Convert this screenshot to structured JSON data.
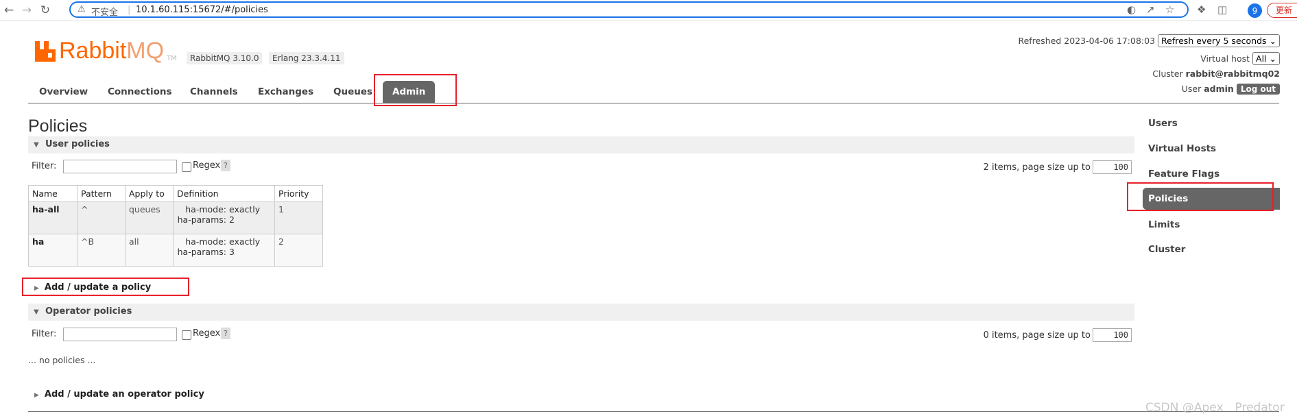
{
  "browser": {
    "security_label": "不安全",
    "url": "10.1.60.115:15672/#/policies",
    "profile_initial": "9",
    "update_label": "更新"
  },
  "header": {
    "logo_text_rabbit": "Rabbit",
    "logo_text_mq": "MQ",
    "logo_tm": "TM",
    "version": "RabbitMQ 3.10.0",
    "erlang": "Erlang 23.3.4.11",
    "refreshed_label": "Refreshed 2023-04-06 17:08:03",
    "refresh_select": "Refresh every 5 seconds",
    "virtual_host_label": "Virtual host",
    "virtual_host_value": "All",
    "cluster_label": "Cluster",
    "cluster_value": "rabbit@rabbitmq02",
    "user_label": "User",
    "user_value": "admin",
    "logout_label": "Log out"
  },
  "tabs": [
    "Overview",
    "Connections",
    "Channels",
    "Exchanges",
    "Queues",
    "Admin"
  ],
  "page_title": "Policies",
  "user_policies": {
    "title": "User policies",
    "filter_label": "Filter:",
    "regex_label": "Regex",
    "help": "?",
    "items_label": "2 items, page size up to",
    "page_size": "100",
    "columns": [
      "Name",
      "Pattern",
      "Apply to",
      "Definition",
      "Priority"
    ],
    "rows": [
      {
        "name": "ha-all",
        "pattern": "^",
        "apply_to": "queues",
        "def_key1": "ha-mode:",
        "def_val1": "exactly",
        "def_key2": "ha-params:",
        "def_val2": "2",
        "priority": "1"
      },
      {
        "name": "ha",
        "pattern": "^B",
        "apply_to": "all",
        "def_key1": "ha-mode:",
        "def_val1": "exactly",
        "def_key2": "ha-params:",
        "def_val2": "3",
        "priority": "2"
      }
    ],
    "add_label": "Add / update a policy"
  },
  "operator_policies": {
    "title": "Operator policies",
    "filter_label": "Filter:",
    "regex_label": "Regex",
    "help": "?",
    "items_label": "0 items, page size up to",
    "page_size": "100",
    "empty_label": "... no policies ...",
    "add_label": "Add / update an operator policy"
  },
  "sidebar": [
    "Users",
    "Virtual Hosts",
    "Feature Flags",
    "Policies",
    "Limits",
    "Cluster"
  ],
  "watermark": "CSDN @Apex　Predator",
  "colors": {
    "brand": "#ff6600",
    "tab_active": "#666666",
    "highlight": "#e8202a",
    "omnibox_border": "#1a73e8"
  }
}
